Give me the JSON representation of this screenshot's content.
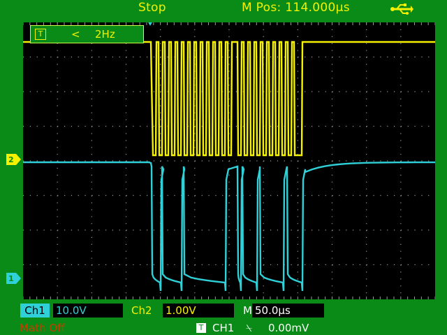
{
  "status": {
    "run_state": "Stop",
    "m_pos": "M Pos: 114.000µs",
    "usb_icon": "usb-icon"
  },
  "trigger_box": {
    "icon": "T",
    "condition": "<",
    "frequency": "2Hz"
  },
  "markers": {
    "ch2": "2",
    "ch1": "1"
  },
  "bottom": {
    "ch1_label": "Ch1",
    "ch1_scale": "10.0V",
    "ch2_label": "Ch2",
    "ch2_scale": "1.00V",
    "m_label": "M",
    "timebase": "50.0µs",
    "math": "Math Off",
    "trigger_icon": "T",
    "trigger_source": "CH1",
    "trigger_slope": "⍀",
    "trigger_level": "0.00mV"
  },
  "colors": {
    "frame": "#0a8a16",
    "ch1": "#2fd0d8",
    "ch2": "#f4f200",
    "math": "#c04000"
  }
}
